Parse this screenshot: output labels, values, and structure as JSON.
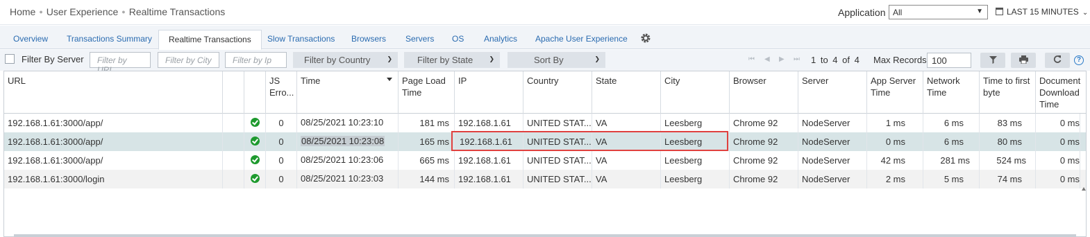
{
  "breadcrumb": [
    "Home",
    "User Experience",
    "Realtime Transactions"
  ],
  "application": {
    "label": "Application",
    "value": "All"
  },
  "time_range": "LAST 15 MINUTES",
  "tabs": [
    {
      "label": "Overview"
    },
    {
      "label": "Transactions Summary"
    },
    {
      "label": "Realtime Transactions"
    },
    {
      "label": "Slow Transactions"
    },
    {
      "label": "Browsers"
    },
    {
      "label": "Servers"
    },
    {
      "label": "OS"
    },
    {
      "label": "Analytics"
    },
    {
      "label": "Apache User Experience"
    }
  ],
  "filters": {
    "filter_by_server": "Filter By Server",
    "url_placeholder": "Filter by URL",
    "city_placeholder": "Filter by City",
    "ip_placeholder": "Filter by Ip",
    "country": "Filter by Country",
    "state": "Filter by State",
    "sort": "Sort By"
  },
  "pagination": {
    "text": "1 to 4 of 4",
    "max_records_label": "Max Records",
    "max_records": "100"
  },
  "columns": [
    "URL",
    "",
    "",
    "JS Erro...",
    "Time",
    "Page Load Time",
    "IP",
    "Country",
    "State",
    "City",
    "Browser",
    "Server",
    "App Server Time",
    "Network Time",
    "Time to first byte",
    "Document Download Time"
  ],
  "rows": [
    {
      "url": "192.168.1.61:3000/app/",
      "js": "0",
      "time": "08/25/2021 10:23:10",
      "load": "181 ms",
      "ip": "192.168.1.61",
      "country": "UNITED STAT...",
      "state": "VA",
      "city": "Leesberg",
      "browser": "Chrome 92",
      "server": "NodeServer",
      "app": "1 ms",
      "net": "6 ms",
      "ttfb": "83 ms",
      "doc": "0 ms"
    },
    {
      "url": "192.168.1.61:3000/app/",
      "js": "0",
      "time": "08/25/2021 10:23:08",
      "load": "165 ms",
      "ip": "192.168.1.61",
      "country": "UNITED STAT...",
      "state": "VA",
      "city": "Leesberg",
      "browser": "Chrome 92",
      "server": "NodeServer",
      "app": "0 ms",
      "net": "6 ms",
      "ttfb": "80 ms",
      "doc": "0 ms"
    },
    {
      "url": "192.168.1.61:3000/app/",
      "js": "0",
      "time": "08/25/2021 10:23:06",
      "load": "665 ms",
      "ip": "192.168.1.61",
      "country": "UNITED STAT...",
      "state": "VA",
      "city": "Leesberg",
      "browser": "Chrome 92",
      "server": "NodeServer",
      "app": "42 ms",
      "net": "281 ms",
      "ttfb": "524 ms",
      "doc": "0 ms"
    },
    {
      "url": "192.168.1.61:3000/login",
      "js": "0",
      "time": "08/25/2021 10:23:03",
      "load": "144 ms",
      "ip": "192.168.1.61",
      "country": "UNITED STAT...",
      "state": "VA",
      "city": "Leesberg",
      "browser": "Chrome 92",
      "server": "NodeServer",
      "app": "2 ms",
      "net": "5 ms",
      "ttfb": "74 ms",
      "doc": "0 ms"
    }
  ],
  "selected_row": 1,
  "colors": {
    "accent": "#2a6bb0",
    "status_ok": "#1e9a2e",
    "highlight": "#e0413f",
    "selected_row": "#d7e4e6"
  },
  "icons": [
    "calendar-icon",
    "gear-icon",
    "filter-icon",
    "print-icon",
    "refresh-icon",
    "help-icon",
    "check-circle-icon"
  ]
}
